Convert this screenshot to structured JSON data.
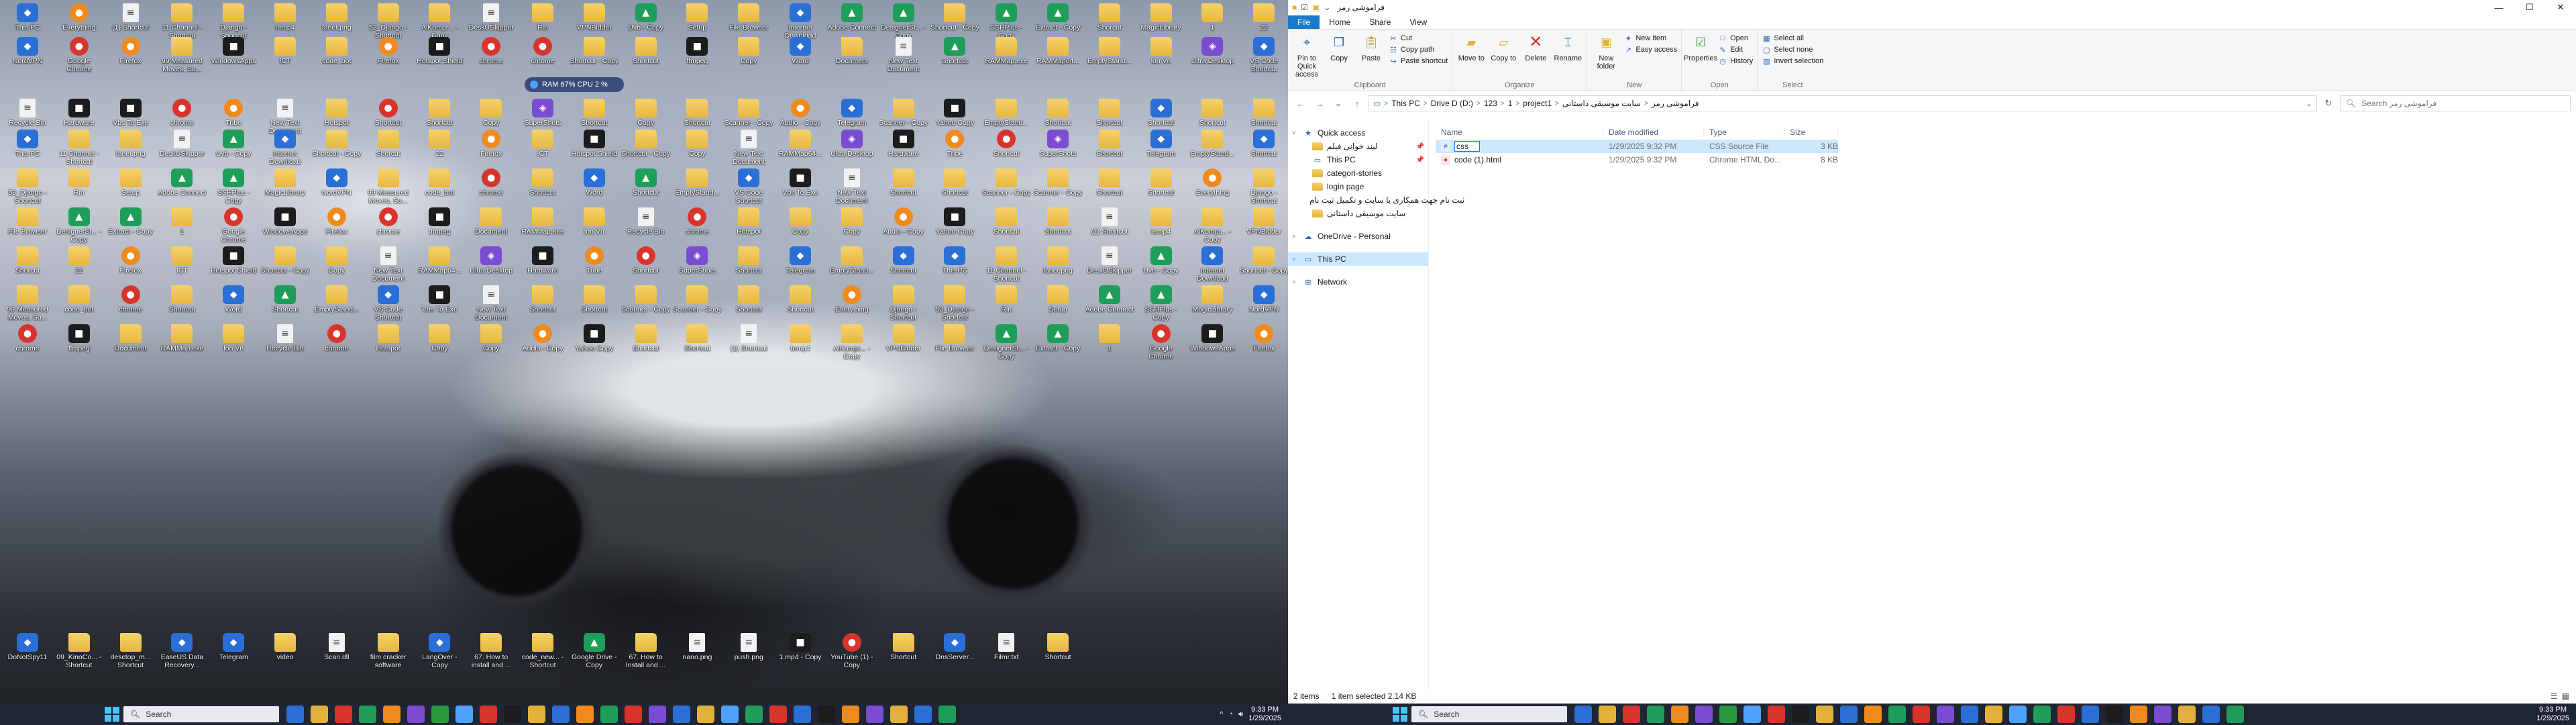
{
  "desktop": {
    "perf_widget": "RAM 67% CPU 2 %",
    "icons": [
      {
        "label": "This PC",
        "kind": "app"
      },
      {
        "label": "Everything",
        "kind": "orange"
      },
      {
        "label": "(1) Shortcut",
        "kind": "doc"
      },
      {
        "label": "11 Channel - Shortcut",
        "kind": "folder"
      },
      {
        "label": "Django - Shortcut",
        "kind": "folder"
      },
      {
        "label": "temp4",
        "kind": "folder"
      },
      {
        "label": "fanet.png",
        "kind": "folder"
      },
      {
        "label": "53_Django - Shortcut",
        "kind": "folder"
      },
      {
        "label": "AiKompr... - Copy",
        "kind": "folder"
      },
      {
        "label": "DeskUSkipper",
        "kind": "doc"
      },
      {
        "label": "Rin",
        "kind": "folder"
      },
      {
        "label": "VPNBidder",
        "kind": "folder"
      },
      {
        "label": "Uvb - Copy",
        "kind": "green"
      },
      {
        "label": "Setup",
        "kind": "folder"
      },
      {
        "label": "File Browser",
        "kind": "folder"
      },
      {
        "label": "Internet Download",
        "kind": "app"
      },
      {
        "label": "Adobe Connect",
        "kind": "green"
      },
      {
        "label": "DesignerSt... - Copy",
        "kind": "green"
      },
      {
        "label": "Shortcut - Copy",
        "kind": "folder"
      },
      {
        "label": "SSHPlus - Copy",
        "kind": "green"
      },
      {
        "label": "Extract - Copy",
        "kind": "green"
      },
      {
        "label": "Shorcut",
        "kind": "folder"
      },
      {
        "label": "MagicLibrary",
        "kind": "folder"
      },
      {
        "label": "1",
        "kind": "folder"
      },
      {
        "label": "22",
        "kind": "folder"
      },
      {
        "label": "NordVPN",
        "kind": "app"
      },
      {
        "label": "Google Chrome",
        "kind": "red"
      },
      {
        "label": "Firefox",
        "kind": "orange"
      },
      {
        "label": "99 Measured Moves, Su...",
        "kind": "folder"
      },
      {
        "label": "WindowsApps",
        "kind": "dark"
      },
      {
        "label": "ICT",
        "kind": "folder"
      },
      {
        "label": "code_bot",
        "kind": "folder"
      },
      {
        "label": "Firefox",
        "kind": "orange"
      },
      {
        "label": "Hotspot Shield",
        "kind": "dark"
      },
      {
        "label": "chrome",
        "kind": "red"
      },
      {
        "label": "chrome",
        "kind": "red"
      },
      {
        "label": "Shortcut - Copy",
        "kind": "folder"
      },
      {
        "label": "Shortcut",
        "kind": "folder"
      },
      {
        "label": "ffmpeg",
        "kind": "dark"
      },
      {
        "label": "Copy",
        "kind": "folder"
      },
      {
        "label": "Word",
        "kind": "app"
      },
      {
        "label": "Document",
        "kind": "folder"
      },
      {
        "label": "New Text Document",
        "kind": "doc"
      },
      {
        "label": "Shortcut",
        "kind": "green"
      },
      {
        "label": "RAMMap.exe",
        "kind": "folder"
      },
      {
        "label": "RAMMap64...",
        "kind": "folder"
      },
      {
        "label": "EmptyStand...",
        "kind": "folder"
      },
      {
        "label": "lon Vn",
        "kind": "folder"
      },
      {
        "label": "Ultra Desktop",
        "kind": "purple"
      },
      {
        "label": "VS Code Shortcut",
        "kind": "app"
      },
      {
        "label": "Recycle Bin",
        "kind": "doc"
      },
      {
        "label": "Hardware",
        "kind": "dark"
      },
      {
        "label": "Vbs To Exe",
        "kind": "dark"
      },
      {
        "label": "chrome",
        "kind": "red"
      },
      {
        "label": "Tribe",
        "kind": "orange"
      },
      {
        "label": "New Text Document",
        "kind": "doc"
      },
      {
        "label": "Hotspot",
        "kind": "folder"
      },
      {
        "label": "Shortcut",
        "kind": "red"
      },
      {
        "label": "Shortcut",
        "kind": "folder"
      },
      {
        "label": "Copy",
        "kind": "folder"
      },
      {
        "label": "SuperShots",
        "kind": "purple"
      },
      {
        "label": "Shortcut",
        "kind": "folder"
      },
      {
        "label": "Copy",
        "kind": "folder"
      },
      {
        "label": "Shortcut",
        "kind": "folder"
      },
      {
        "label": "Scanner - Copy",
        "kind": "folder"
      },
      {
        "label": "Audio - Copy",
        "kind": "orange"
      },
      {
        "label": "Telegram",
        "kind": "app"
      },
      {
        "label": "Scanner - Copy",
        "kind": "folder"
      },
      {
        "label": "Yahoo Copy",
        "kind": "dark"
      },
      {
        "label": "EmptyStand...",
        "kind": "folder"
      },
      {
        "label": "Shortcut",
        "kind": "folder"
      },
      {
        "label": "Shortcut",
        "kind": "folder"
      },
      {
        "label": "Shortcut",
        "kind": "app"
      },
      {
        "label": "Shortcut",
        "kind": "folder"
      },
      {
        "label": "Shortcut",
        "kind": "folder"
      }
    ],
    "bottom_row": [
      {
        "label": "DoNotSpy11",
        "kind": "app"
      },
      {
        "label": "09_KinoCo... - Shortcut",
        "kind": "folder"
      },
      {
        "label": "desctop_m... Shortcut",
        "kind": "folder"
      },
      {
        "label": "EaseUS Data Recovery...",
        "kind": "app"
      },
      {
        "label": "Telegram",
        "kind": "app"
      },
      {
        "label": "video",
        "kind": "folder"
      },
      {
        "label": "Scan.dll",
        "kind": "doc"
      },
      {
        "label": "film cracker software",
        "kind": "folder"
      },
      {
        "label": "LangOver - Copy",
        "kind": "app"
      },
      {
        "label": "67. How to install and ...",
        "kind": "folder"
      },
      {
        "label": "code_new... - Shortcut",
        "kind": "folder"
      },
      {
        "label": "Google Drive - Copy",
        "kind": "green"
      },
      {
        "label": "67. How to Install and ...",
        "kind": "folder"
      },
      {
        "label": "nano.png",
        "kind": "doc"
      },
      {
        "label": "push.png",
        "kind": "doc"
      },
      {
        "label": "1.mp4 - Copy",
        "kind": "dark"
      },
      {
        "label": "YouTube (1) - Copy",
        "kind": "red"
      },
      {
        "label": "Shortcut",
        "kind": "folder"
      },
      {
        "label": "DnsServer...",
        "kind": "app"
      },
      {
        "label": "Filmr.txt",
        "kind": "doc"
      },
      {
        "label": "Shortcut",
        "kind": "folder"
      }
    ]
  },
  "left_taskbar": {
    "search_placeholder": "Search",
    "clock_time": "9:33 PM",
    "clock_date": "1/29/2025"
  },
  "right_taskbar": {
    "search_placeholder": "Search",
    "clock_time": "9:33 PM",
    "clock_date": "1/29/2025"
  },
  "explorer": {
    "window_title": "فراموشی رمز",
    "window_controls": {
      "minimize": "—",
      "maximize": "☐",
      "close": "✕"
    },
    "ribbon_tabs": [
      "File",
      "Home",
      "Share",
      "View"
    ],
    "ribbon": {
      "clipboard": {
        "group": "Clipboard",
        "pin": "Pin to Quick access",
        "copy": "Copy",
        "paste": "Paste",
        "cut": "Cut",
        "copy_path": "Copy path",
        "paste_shortcut": "Paste shortcut"
      },
      "organize": {
        "group": "Organize",
        "move_to": "Move to",
        "copy_to": "Copy to",
        "delete": "Delete",
        "rename": "Rename"
      },
      "new": {
        "group": "New",
        "new_folder": "New folder",
        "new_item": "New item",
        "easy_access": "Easy access"
      },
      "open": {
        "group": "Open",
        "properties": "Properties",
        "open": "Open",
        "edit": "Edit",
        "history": "History"
      },
      "select": {
        "group": "Select",
        "select_all": "Select all",
        "select_none": "Select none",
        "invert": "Invert selection"
      }
    },
    "address": {
      "crumbs": [
        "This PC",
        "Drive D (D:)",
        "123",
        "1",
        "project1",
        "سایت موسیقی داستانی",
        "فراموشی رمز"
      ]
    },
    "search_placeholder": "Search فراموشی رمز",
    "nav": [
      {
        "label": "Quick access",
        "icon": "star",
        "level": 0,
        "expander": "˅",
        "pin": ""
      },
      {
        "label": "لیند خوانی فیلم",
        "icon": "folder",
        "level": 1,
        "expander": "",
        "pin": "📌"
      },
      {
        "label": "This PC",
        "icon": "pc",
        "level": 1,
        "expander": "",
        "pin": "📌"
      },
      {
        "label": "categori-stories",
        "icon": "folder",
        "level": 1,
        "expander": "",
        "pin": ""
      },
      {
        "label": "login page",
        "icon": "folder",
        "level": 1,
        "expander": "",
        "pin": ""
      },
      {
        "label": "ثبت نام جهت همکاری با سایت و تکمیل ثبت نام",
        "icon": "folder",
        "level": 1,
        "expander": "",
        "pin": ""
      },
      {
        "label": "سایت موسیقی داستانی",
        "icon": "folder",
        "level": 1,
        "expander": "",
        "pin": ""
      },
      {
        "label": "OneDrive - Personal",
        "icon": "cloud",
        "level": 0,
        "expander": ">",
        "pin": ""
      },
      {
        "label": "This PC",
        "icon": "pc",
        "level": 0,
        "expander": ">",
        "pin": "",
        "selected": true
      },
      {
        "label": "Network",
        "icon": "net",
        "level": 0,
        "expander": ">",
        "pin": ""
      }
    ],
    "columns": [
      "Name",
      "Date modified",
      "Type",
      "Size"
    ],
    "files": [
      {
        "name": "css",
        "date": "1/29/2025 9:32 PM",
        "type": "CSS Source File",
        "size": "3 KB",
        "selected": true,
        "renaming": true,
        "icon": "css"
      },
      {
        "name": "code (1).html",
        "date": "1/29/2025 9:32 PM",
        "type": "Chrome HTML Do...",
        "size": "8 KB",
        "selected": false,
        "renaming": false,
        "icon": "html"
      }
    ],
    "status": {
      "items": "2 items",
      "selected": "1 item selected  2.14 KB"
    }
  }
}
